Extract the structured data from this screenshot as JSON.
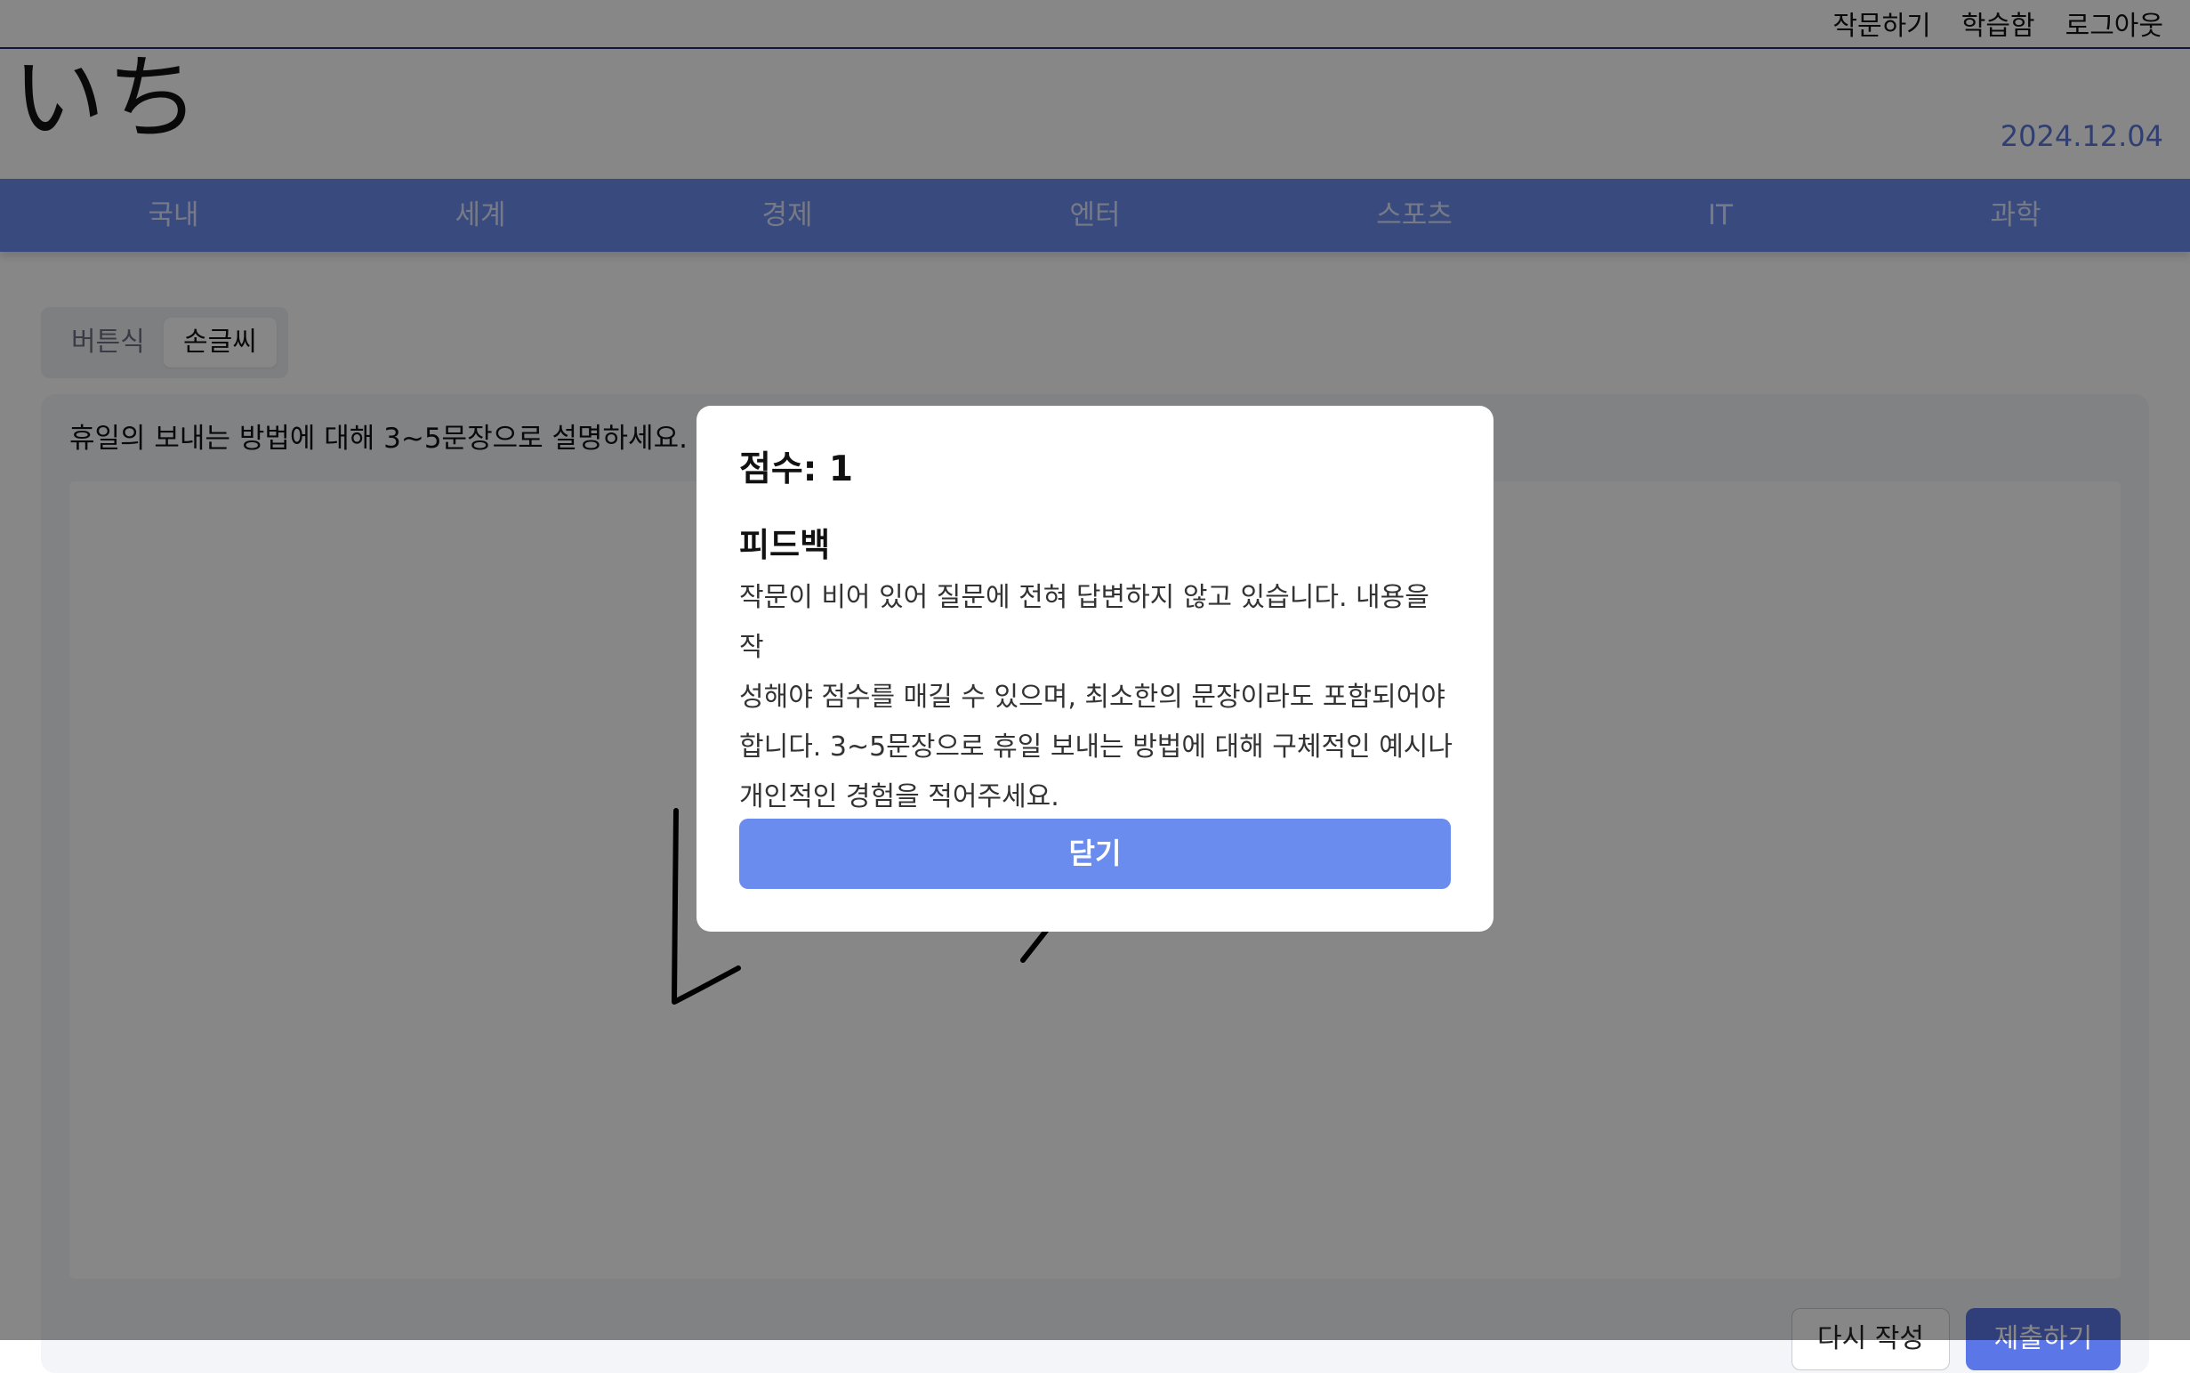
{
  "top_links": [
    "작문하기",
    "학습함",
    "로그아웃"
  ],
  "logo": "いち",
  "date": "2024.12.04",
  "nav": [
    "국내",
    "세계",
    "경제",
    "엔터",
    "스포츠",
    "IT",
    "과학"
  ],
  "mode_tabs": {
    "button_mode": "버튼식",
    "handwriting_mode": "손글씨"
  },
  "prompt": "휴일의 보내는 방법에 대해 3~5문장으로 설명하세요.",
  "actions": {
    "reset": "다시 작성",
    "submit": "제출하기"
  },
  "modal": {
    "score": "점수: 1",
    "heading": "피드백",
    "body_lines": [
      "작문이 비어 있어 질문에 전혀 답변하지 않고 있습니다. 내용을 작",
      "성해야 점수를 매길 수 있으며, 최소한의 문장이라도 포함되어야",
      "합니다. 3~5문장으로 휴일 보내는 방법에 대해 구체적인 예시나",
      "개인적인 경험을 적어주세요."
    ],
    "close": "닫기"
  },
  "colors": {
    "nav_bg": "#6b8cef",
    "accent": "#5b76e6",
    "date": "#5b76d6",
    "overlay": "rgba(0,0,0,0.47)"
  }
}
